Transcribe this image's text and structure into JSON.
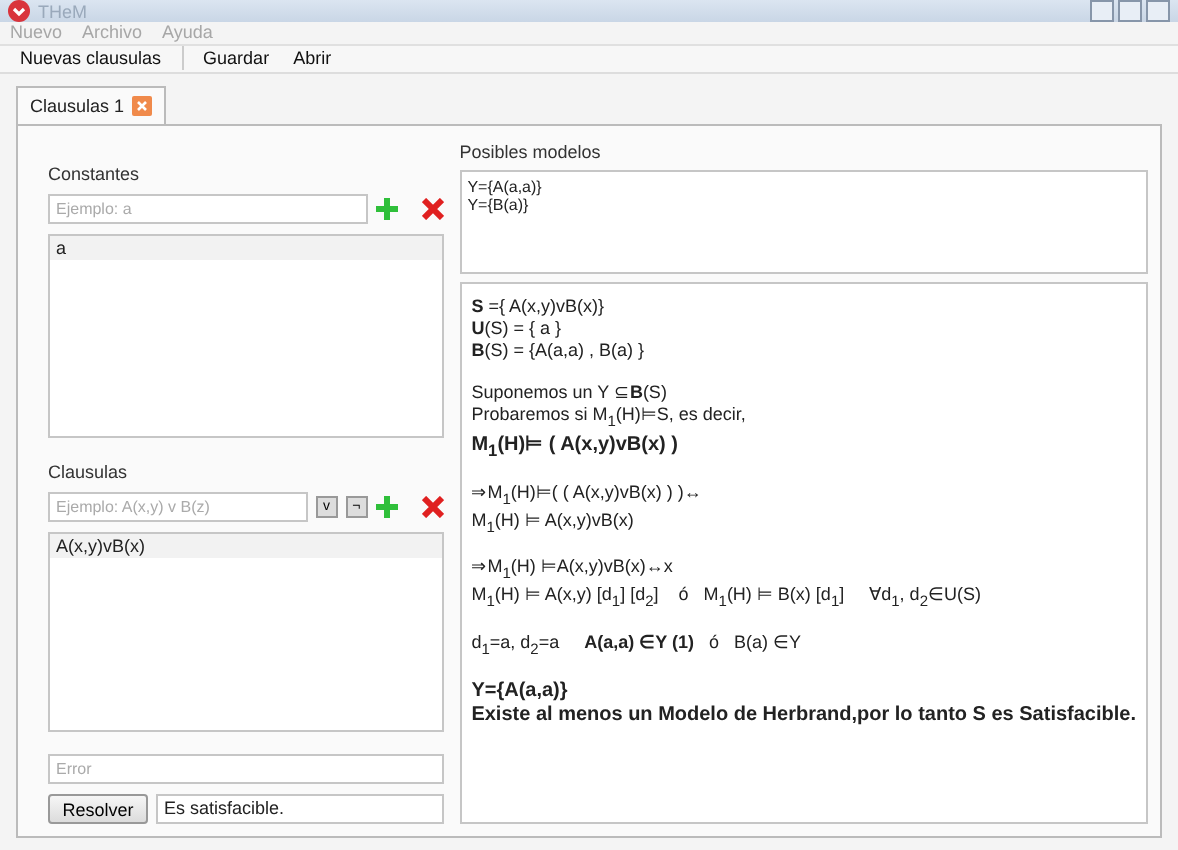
{
  "window": {
    "title": "THeM"
  },
  "menu": [
    "Nuevo",
    "Archivo",
    "Ayuda"
  ],
  "toolbar": [
    "Nuevas clausulas",
    "Guardar",
    "Abrir"
  ],
  "tabs": [
    {
      "label": "Clausulas 1",
      "selected": true
    }
  ],
  "constants": {
    "label": "Constantes",
    "placeholder": "Ejemplo: a",
    "items": [
      "a"
    ]
  },
  "clauses": {
    "label": "Clausulas",
    "placeholder": "Ejemplo: A(x,y) v B(z)",
    "operators": [
      "v",
      "¬"
    ],
    "items": [
      "A(x,y)vB(x)"
    ]
  },
  "error": {
    "placeholder": "Error"
  },
  "resolve": {
    "button": "Resolver",
    "result": "Es satisfacible."
  },
  "models": {
    "label": "Posibles modelos",
    "items": [
      "Y={A(a,a)}",
      "Y={B(a)}"
    ]
  },
  "explanation": [
    {
      "lines": [
        {
          "text": "**S** ={ A(x,y)vB(x)}",
          "bold": false
        },
        {
          "text": "**U**(S) = { a }",
          "bold": false
        },
        {
          "text": "**B**(S) = {A(a,a) , B(a) }",
          "bold": false
        }
      ]
    },
    {
      "lines": [
        {
          "text": "Suponemos un Y ⊆**B**(S)",
          "bold": false
        },
        {
          "text": "Probaremos si M$_{1}$(H)⊨S, es decir,",
          "bold": false
        },
        {
          "text": "M$_{1}$(H)⊨ ( A(x,y)vB(x) )",
          "bold": true
        }
      ]
    },
    {
      "lines": [
        {
          "text": "⇒M$_{1}$(H)⊨( ( A(x,y)vB(x) ) )↔",
          "bold": false
        },
        {
          "text": "M$_{1}$(H) ⊨ A(x,y)vB(x)",
          "bold": false
        }
      ]
    },
    {
      "lines": [
        {
          "text": "⇒M$_{1}$(H) ⊨A(x,y)vB(x)↔x",
          "bold": false
        },
        {
          "text": "M$_{1}$(H) ⊨ A(x,y) [d$_{1}$] [d$_{2}$]    ó   M$_{1}$(H) ⊨ B(x) [d$_{1}$]     ∀d$_{1}$, d$_{2}$∈U(S)",
          "bold": false
        }
      ]
    },
    {
      "lines": [
        {
          "text": "d$_{1}$=a, d$_{2}$=a     **A(a,a) ∈Y (1)**   ó   B(a) ∈Y",
          "bold": false
        }
      ]
    },
    {
      "lines": [
        {
          "text": "Y={A(a,a)}",
          "bold": true
        },
        {
          "text": "Existe al menos un Modelo de Herbrand,por lo tanto S es Satisfacible.",
          "bold": true
        }
      ]
    }
  ]
}
